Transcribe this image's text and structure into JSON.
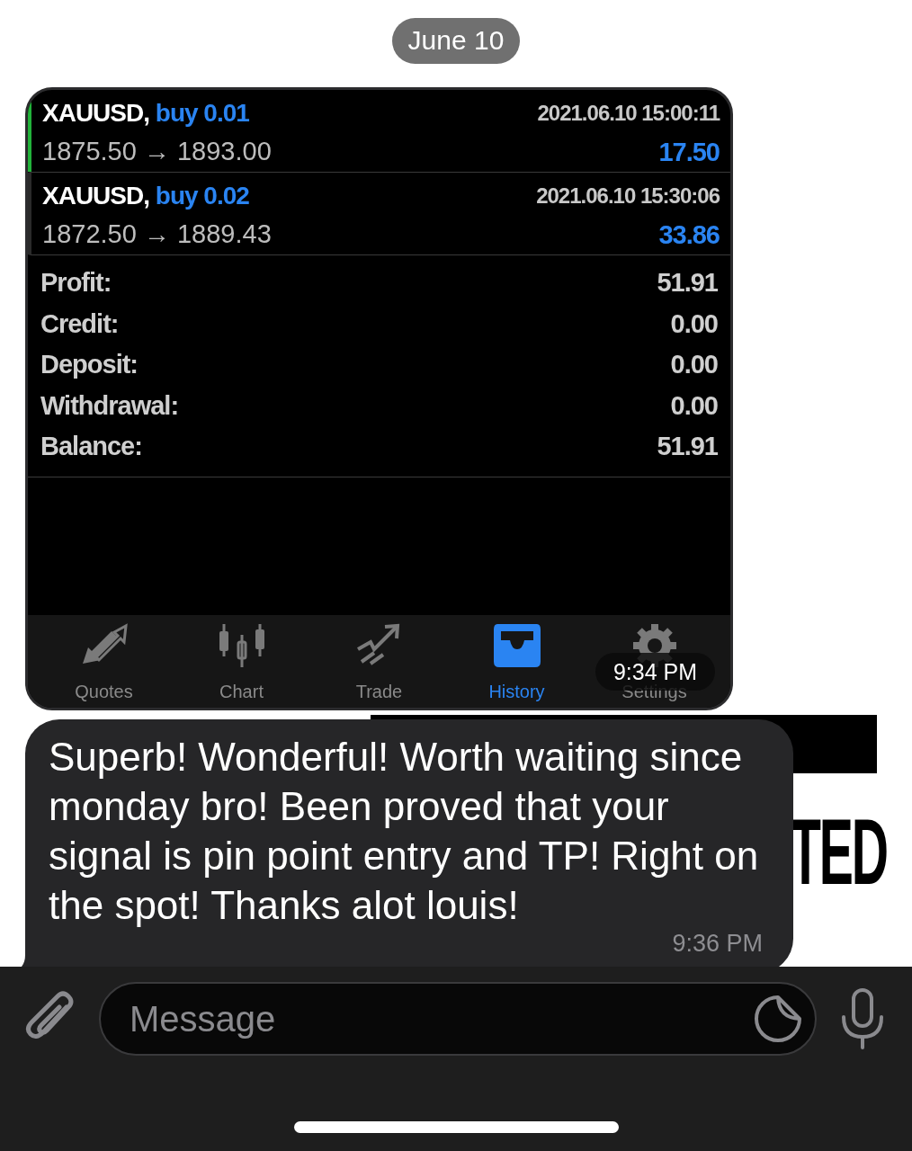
{
  "date_pill": "June 10",
  "image_message": {
    "trades": [
      {
        "symbol": "XAUUSD,",
        "side": "buy 0.01",
        "time": "2021.06.10 15:00:11",
        "prices": "1875.50 → 1893.00",
        "profit": "17.50",
        "selected": true
      },
      {
        "symbol": "XAUUSD,",
        "side": "buy 0.02",
        "time": "2021.06.10 15:30:06",
        "prices": "1872.50 → 1889.43",
        "profit": "33.86",
        "selected": false
      }
    ],
    "summary": [
      {
        "label": "Profit:",
        "value": "51.91"
      },
      {
        "label": "Credit:",
        "value": "0.00"
      },
      {
        "label": "Deposit:",
        "value": "0.00"
      },
      {
        "label": "Withdrawal:",
        "value": "0.00"
      },
      {
        "label": "Balance:",
        "value": "51.91"
      }
    ],
    "tabs": [
      {
        "label": "Quotes",
        "kind": "quotes",
        "selected": false
      },
      {
        "label": "Chart",
        "kind": "chart",
        "selected": false
      },
      {
        "label": "Trade",
        "kind": "trade",
        "selected": false
      },
      {
        "label": "History",
        "kind": "history",
        "selected": true
      },
      {
        "label": "Settings",
        "kind": "settings",
        "selected": false
      }
    ],
    "time": "9:34 PM"
  },
  "background": {
    "text": "TED"
  },
  "message": {
    "text": "Superb! Wonderful! Worth waiting since monday bro! Been proved that your signal is pin point entry and TP! Right on the spot! Thanks alot louis!",
    "time": "9:36 PM"
  },
  "composer": {
    "placeholder": "Message"
  }
}
